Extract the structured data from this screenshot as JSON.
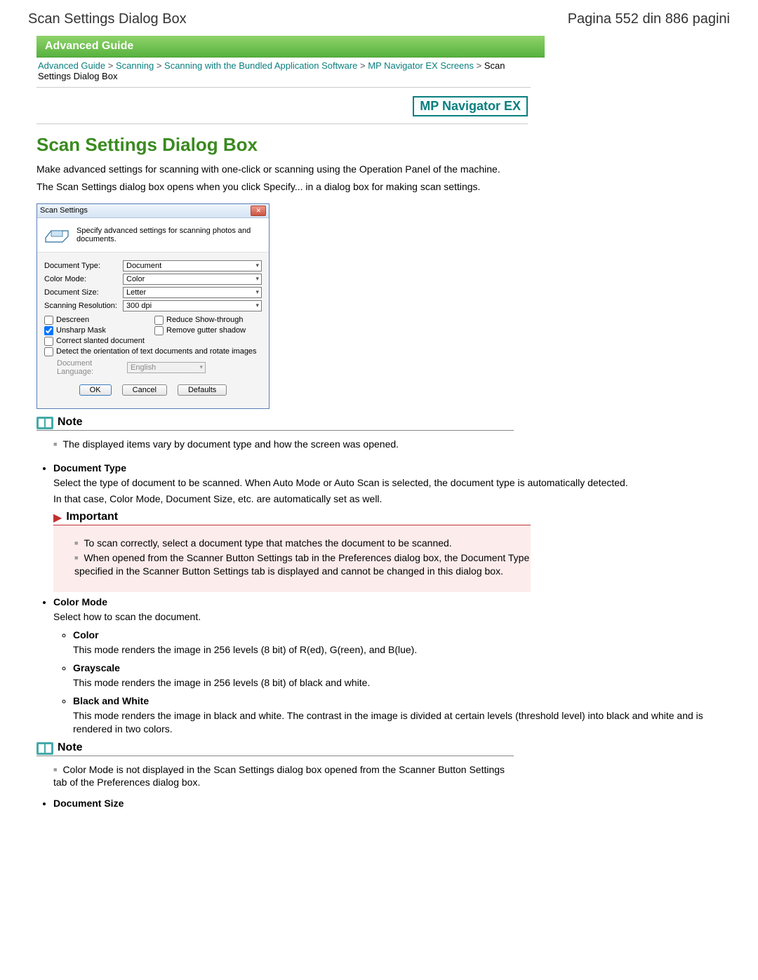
{
  "top": {
    "left": "Scan Settings Dialog Box",
    "right": "Pagina 552 din 886 pagini"
  },
  "adv_guide_bar": "Advanced Guide",
  "breadcrumb": {
    "items": [
      "Advanced Guide",
      "Scanning",
      "Scanning with the Bundled Application Software",
      "MP Navigator EX Screens"
    ],
    "tail": "Scan Settings Dialog Box",
    "sep": ">"
  },
  "mp_badge": "MP Navigator EX",
  "heading": "Scan Settings Dialog Box",
  "intro1": "Make advanced settings for scanning with one-click or scanning using the Operation Panel of the machine.",
  "intro2": "The Scan Settings dialog box opens when you click Specify... in a dialog box for making scan settings.",
  "dialog": {
    "title": "Scan Settings",
    "header_text": "Specify advanced settings for scanning photos and documents.",
    "rows": {
      "doc_type": {
        "label": "Document Type:",
        "value": "Document"
      },
      "color_mode": {
        "label": "Color Mode:",
        "value": "Color"
      },
      "doc_size": {
        "label": "Document Size:",
        "value": "Letter"
      },
      "resolution": {
        "label": "Scanning Resolution:",
        "value": "300 dpi"
      }
    },
    "checks": {
      "descreen": "Descreen",
      "reduce": "Reduce Show-through",
      "unsharp": "Unsharp Mask",
      "gutter": "Remove gutter shadow",
      "slanted": "Correct slanted document",
      "detect": "Detect the orientation of text documents and rotate images"
    },
    "lang": {
      "label": "Document Language:",
      "value": "English"
    },
    "buttons": {
      "ok": "OK",
      "cancel": "Cancel",
      "defaults": "Defaults"
    }
  },
  "notes": {
    "note_label": "Note",
    "important_label": "Important",
    "note1_item": "The displayed items vary by document type and how the screen was opened.",
    "note2_item": "Color Mode is not displayed in the Scan Settings dialog box opened from the Scanner Button Settings tab of the Preferences dialog box."
  },
  "sections": {
    "doc_type": {
      "title": "Document Type",
      "p1": "Select the type of document to be scanned. When Auto Mode or Auto Scan is selected, the document type is automatically detected.",
      "p2": "In that case, Color Mode, Document Size, etc. are automatically set as well.",
      "important": [
        "To scan correctly, select a document type that matches the document to be scanned.",
        "When opened from the Scanner Button Settings tab in the Preferences dialog box, the Document Type specified in the Scanner Button Settings tab is displayed and cannot be changed in this dialog box."
      ]
    },
    "color_mode": {
      "title": "Color Mode",
      "p1": "Select how to scan the document.",
      "items": [
        {
          "title": "Color",
          "desc": "This mode renders the image in 256 levels (8 bit) of R(ed), G(reen), and B(lue)."
        },
        {
          "title": "Grayscale",
          "desc": "This mode renders the image in 256 levels (8 bit) of black and white."
        },
        {
          "title": "Black and White",
          "desc": "This mode renders the image in black and white. The contrast in the image is divided at certain levels (threshold level) into black and white and is rendered in two colors."
        }
      ]
    },
    "doc_size": {
      "title": "Document Size"
    }
  }
}
